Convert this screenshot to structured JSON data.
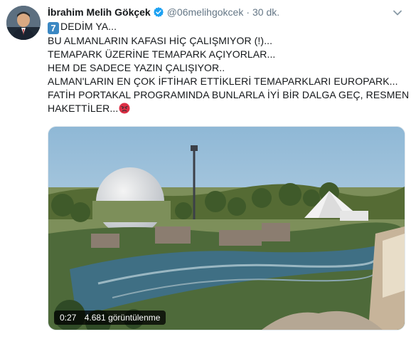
{
  "tweet": {
    "author_name": "İbrahim Melih Gökçek",
    "handle": "@06melihgokcek",
    "separator": "·",
    "time": "30 dk.",
    "lines": [
      {
        "emoji": "7",
        "text": "DEDİM YA..."
      },
      {
        "text": "BU ALMANLARIN KAFASI HİÇ ÇALIŞMIYOR (!)..."
      },
      {
        "text": "TEMAPARK ÜZERİNE TEMAPARK AÇIYORLAR..."
      },
      {
        "text": "HEM DE SADECE YAZIN ÇALIŞIYOR.."
      },
      {
        "text": "ALMAN'LARIN EN ÇOK İFTİHAR ETTİKLERİ TEMAPARKLARI EUROPARK..."
      },
      {
        "text": "FATİH PORTAKAL PROGRAMINDA BUNLARLA İYİ BİR DALGA GEÇ, RESMEN"
      },
      {
        "text": "HAKETTİLER...",
        "emoji_after": "angry-face"
      }
    ],
    "video": {
      "duration": "0:27",
      "views": "4.681 görüntülenme"
    }
  },
  "colors": {
    "verified_blue": "#1da1f2",
    "keycap_blue": "#3b88c3",
    "secondary_text": "#657786",
    "angry_red": "#dd2e44"
  },
  "icons": [
    "verified-badge-icon",
    "chevron-down-icon",
    "keycap-seven-emoji",
    "angry-face-emoji"
  ]
}
